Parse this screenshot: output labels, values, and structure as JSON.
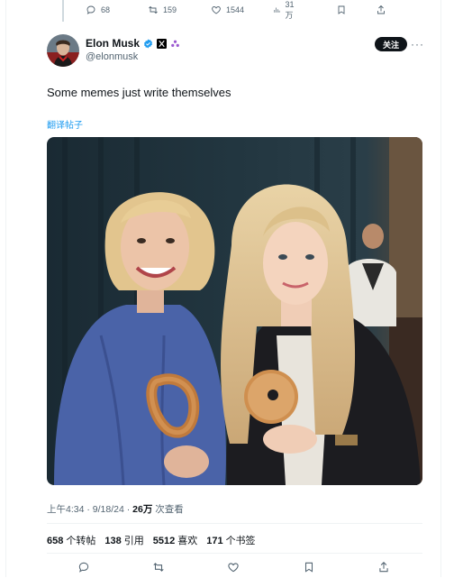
{
  "prev_tweet_actions": {
    "replies": "68",
    "retweets": "159",
    "likes": "1544",
    "views": "31万"
  },
  "author": {
    "name": "Elon Musk",
    "handle": "@elonmusk"
  },
  "follow_label": "关注",
  "more_label": "···",
  "tweet": {
    "text": "Some memes just write themselves",
    "translate_label": "翻译帖子"
  },
  "meta": {
    "time": "上午4:34 · 9/18/24 · ",
    "views_count": "26万",
    "views_label": " 次查看"
  },
  "stats": {
    "retweets": {
      "count": "658",
      "label": "个转帖"
    },
    "quotes": {
      "count": "138",
      "label": "引用"
    },
    "likes": {
      "count": "5512",
      "label": "喜欢"
    },
    "bookmarks": {
      "count": "171",
      "label": "个书签"
    }
  },
  "colors": {
    "accent": "#1d9bf0",
    "verified": "#1d9bf0",
    "text_secondary": "#536471"
  }
}
